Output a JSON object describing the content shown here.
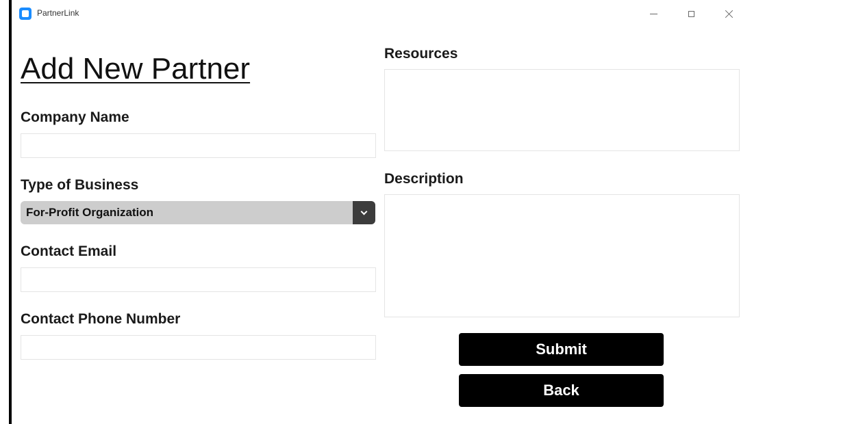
{
  "window": {
    "title": "PartnerLink"
  },
  "form": {
    "heading": "Add New Partner",
    "company_name": {
      "label": "Company Name",
      "value": ""
    },
    "business_type": {
      "label": "Type of Business",
      "selected": "For-Profit Organization"
    },
    "contact_email": {
      "label": "Contact Email",
      "value": ""
    },
    "contact_phone": {
      "label": "Contact Phone Number",
      "value": ""
    },
    "resources": {
      "label": "Resources",
      "value": ""
    },
    "description": {
      "label": "Description",
      "value": ""
    },
    "submit_label": "Submit",
    "back_label": "Back"
  },
  "colors": {
    "accent": "#1a8cff",
    "button_bg": "#000000",
    "select_bg": "#cdcdcd",
    "select_arrow_bg": "#3c3c3c"
  }
}
